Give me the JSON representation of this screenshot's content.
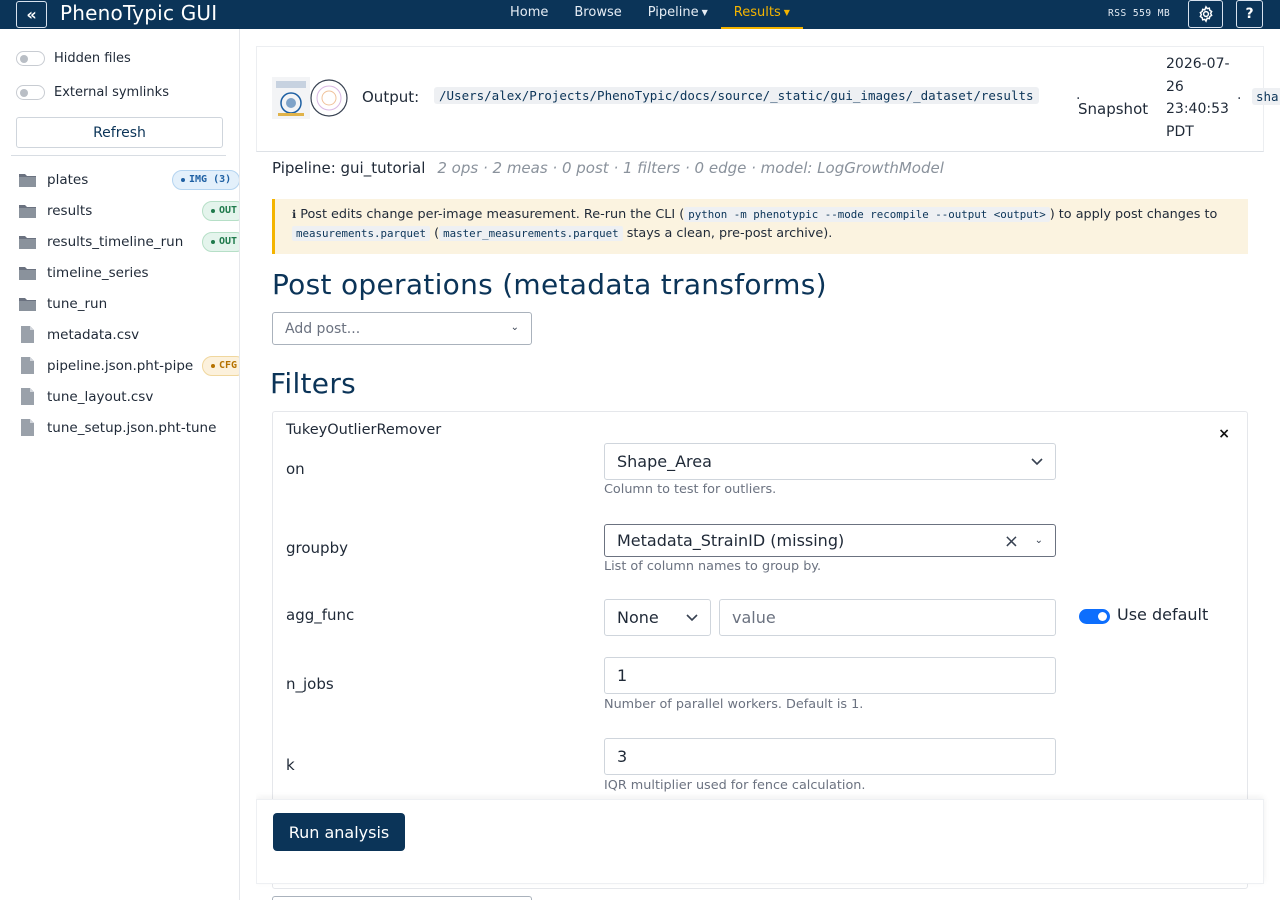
{
  "app": {
    "title": "PhenoTypic GUI",
    "collapse_glyph": "«",
    "rss": "RSS 559 MB",
    "help_glyph": "?"
  },
  "nav": {
    "items": [
      {
        "label": "Home",
        "dropdown": false,
        "active": false
      },
      {
        "label": "Browse",
        "dropdown": false,
        "active": false
      },
      {
        "label": "Pipeline",
        "dropdown": true,
        "active": false
      },
      {
        "label": "Results",
        "dropdown": true,
        "active": true
      }
    ]
  },
  "sidebar": {
    "hidden_files_label": "Hidden files",
    "symlinks_label": "External symlinks",
    "refresh_label": "Refresh",
    "files": [
      {
        "name": "plates",
        "kind": "folder",
        "badge": "IMG (3)",
        "badge_type": "img"
      },
      {
        "name": "results",
        "kind": "folder",
        "badge": "OUT",
        "badge_type": "out"
      },
      {
        "name": "results_timeline_run",
        "kind": "folder",
        "badge": "OUT",
        "badge_type": "out"
      },
      {
        "name": "timeline_series",
        "kind": "folder",
        "badge": "",
        "badge_type": ""
      },
      {
        "name": "tune_run",
        "kind": "folder",
        "badge": "",
        "badge_type": ""
      },
      {
        "name": "metadata.csv",
        "kind": "file",
        "badge": "",
        "badge_type": ""
      },
      {
        "name": "pipeline.json.pht-pipe",
        "kind": "file",
        "badge": "CFG",
        "badge_type": "cfg"
      },
      {
        "name": "tune_layout.csv",
        "kind": "file",
        "badge": "",
        "badge_type": ""
      },
      {
        "name": "tune_setup.json.pht-tune",
        "kind": "file",
        "badge": "",
        "badge_type": ""
      }
    ]
  },
  "output": {
    "label": "Output:",
    "path": "/Users/alex/Projects/PhenoTypic/docs/source/_static/gui_images/_dataset/results",
    "sep": "·",
    "snapshot_label": "Snapshot",
    "snapshot_time": "2026-07-26 23:40:53 PDT",
    "sha_prefix": "sha"
  },
  "pipeline": {
    "name": "Pipeline: gui_tutorial",
    "stats": "2 ops · 2 meas · 0 post · 1 filters · 0 edge · model: LogGrowthModel"
  },
  "alert": {
    "info_glyph": "ℹ",
    "text1": "Post edits change per-image measurement. Re-run the CLI (",
    "code1": "python -m phenotypic --mode recompile --output <output>",
    "text2": ") to apply post changes to",
    "code2": "measurements.parquet",
    "text3": "(",
    "code3": "master_measurements.parquet",
    "text4": "stays a clean, pre-post archive)."
  },
  "post": {
    "title": "Post operations (metadata transforms)",
    "add_placeholder": "Add post..."
  },
  "filters": {
    "title": "Filters",
    "card": {
      "name": "TukeyOutlierRemover",
      "close_glyph": "×",
      "params": {
        "on": {
          "label": "on",
          "value": "Shape_Area",
          "hint": "Column to test for outliers."
        },
        "groupby": {
          "label": "groupby",
          "value": "Metadata_StrainID (missing)",
          "hint": "List of column names to group by."
        },
        "agg_func": {
          "label": "agg_func",
          "select_value": "None",
          "input_placeholder": "value",
          "toggle_label": "Use default",
          "toggle_on": true
        },
        "n_jobs": {
          "label": "n_jobs",
          "value": "1",
          "hint": "Number of parallel workers. Default is 1."
        },
        "k": {
          "label": "k",
          "value": "3",
          "hint": "IQR multiplier used for fence calculation."
        }
      }
    }
  },
  "run": {
    "label": "Run analysis"
  },
  "colors": {
    "navbar": "#0b3458",
    "accent": "#f4b400",
    "primary": "#0d6efd"
  }
}
